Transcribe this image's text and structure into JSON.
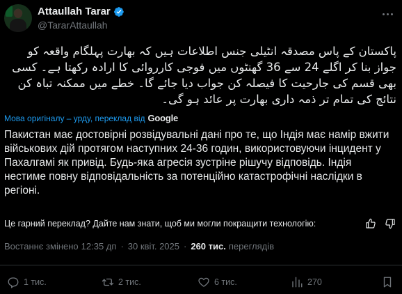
{
  "author": {
    "name": "Attaullah Tarar",
    "handle": "@TararAttaullah"
  },
  "post": {
    "original_text": "پاکستان کے پاس مصدقہ انٹیلی جنس اطلاعات ہیں کہ بھارت پہلگام واقعہ کو جواز بنا کر اگلے 24 سے 36 گھنٹوں میں فوجی کارروائی کا ارادہ رکھتا ہے۔ کسی بھی قسم کی جارحیت کا فیصلہ کن جواب دیا جائے گا۔ خطے میں ممکنہ تباہ کن نتائج کی تمام تر ذمہ داری بھارت پر عائد ہو گی۔",
    "translation_notice": "Мова оригіналу – урду, переклад від",
    "translation_provider": "Google",
    "translated_text": "Пакистан має достовірні розвідувальні дані про те, що Індія має намір вжити військових дій протягом наступних 24-36 годин, використовуючи інцидент у Пахалгамі як привід. Будь-яка агресія зустріне рішучу відповідь. Індія нестиме повну відповідальність за потенційно катастрофічні наслідки в регіоні.",
    "feedback_question": "Це гарний переклад? Дайте нам знати, щоб ми могли покращити технологію:"
  },
  "meta": {
    "edited_label": "Востаннє змінено",
    "time": "12:35 дп",
    "separator": "·",
    "date": "30 квіт. 2025",
    "views_count": "260 тис.",
    "views_label": "переглядів"
  },
  "actions": {
    "replies": "1 тис.",
    "reposts": "2 тис.",
    "likes": "6 тис.",
    "bookmarks": "270"
  },
  "colors": {
    "background": "#000000",
    "text": "#e7e9ea",
    "muted": "#71767b",
    "accent": "#1d9bf0",
    "divider": "#2f3336"
  },
  "icons": [
    "verified-badge-icon",
    "more-icon",
    "thumbs-up-icon",
    "thumbs-down-icon",
    "reply-icon",
    "repost-icon",
    "like-icon",
    "views-icon",
    "bookmark-icon"
  ]
}
